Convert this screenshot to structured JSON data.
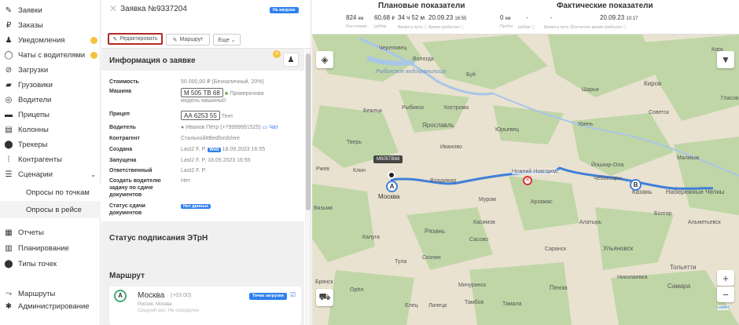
{
  "sidebar": {
    "items": [
      {
        "label": "Заявки",
        "icon": "edit-icon"
      },
      {
        "label": "Заказы",
        "icon": "ruble-icon"
      },
      {
        "label": "Уведомления",
        "icon": "bell-icon"
      },
      {
        "label": "Чаты с водителями",
        "icon": "chat-icon"
      },
      {
        "label": "Загрузки",
        "icon": "upload-icon"
      },
      {
        "label": "Грузовики",
        "icon": "truck-icon"
      },
      {
        "label": "Водители",
        "icon": "steering-icon"
      },
      {
        "label": "Прицепы",
        "icon": "trailer-icon"
      },
      {
        "label": "Колонны",
        "icon": "convoy-icon"
      },
      {
        "label": "Трекеры",
        "icon": "pin-icon"
      },
      {
        "label": "Контрагенты",
        "icon": "contractor-icon"
      },
      {
        "label": "Сценарии",
        "icon": "list-icon"
      }
    ],
    "subitems": [
      "Опросы по точкам",
      "Опросы в рейсе"
    ],
    "bottom": [
      {
        "label": "Отчеты",
        "icon": "report-icon"
      },
      {
        "label": "Планирование",
        "icon": "calendar-icon"
      },
      {
        "label": "Типы точек",
        "icon": "pin-icon"
      },
      {
        "label": "Маршруты",
        "icon": "route-icon"
      },
      {
        "label": "Администрирование",
        "icon": "gear-icon"
      }
    ]
  },
  "order": {
    "close": "✕",
    "title": "Заявка №9337204",
    "status": "На загрузке",
    "edit_label": "Редактировать",
    "route_label": "Маршрут",
    "more_label": "Еще ⌄"
  },
  "info": {
    "title": "Информация о заявке",
    "badge": "4",
    "rows": [
      {
        "k": "Стоимость",
        "v": "50 000,00 ₽ (Безналичный, 20%)"
      },
      {
        "k": "Машина",
        "plate": "М 505 ТВ 68",
        "check": "Проверочная",
        "model": "модель машины0"
      },
      {
        "k": "Прицеп",
        "plate": "АА 6253 55",
        "v": "Тент"
      },
      {
        "k": "Водитель",
        "v": "Иванов Пётр (+79999991525)",
        "chat": "Чат"
      },
      {
        "k": "Контрагент",
        "v": "Стальной#Bedfordshire"
      },
      {
        "k": "Создана",
        "v": "Last2 F. P.",
        "web": "Web",
        "date": "18.09.2023 16:55"
      },
      {
        "k": "Запущена",
        "v": "Last2 F. P. 18.09.2023 16:55"
      },
      {
        "k": "Ответственный",
        "v": "Last2 F. P."
      },
      {
        "k": "Создать водителю задачу по сдаче документов",
        "v": "Нет"
      },
      {
        "k": "Статус сдачи документов",
        "tag": "Нет данных"
      }
    ]
  },
  "etrn": {
    "title": "Статус подписания ЭТрН"
  },
  "route": {
    "title": "Маршрут",
    "point_city": "Москва",
    "point_tz": "(+03:00)",
    "point_region": "Россия, Москва",
    "point_sub": "Средний вес: Не определен",
    "point_tag": "Точка загрузки",
    "marker": "А"
  },
  "plan": {
    "title": "Плановые показатели",
    "dist": "824",
    "dist_unit": "км",
    "cost": "60,68",
    "cost_unit": "₽",
    "time": "34 ч 52 м",
    "arrive": "20.09.23",
    "arrive_time": "16:55",
    "l1": "Расстояние",
    "l2": "руб/км",
    "l3": "Время в пути ⓘ",
    "l4": "Время прибытия ⓘ"
  },
  "fact": {
    "title": "Фактические показатели",
    "dist": "0",
    "dist_unit": "км",
    "cost": "-",
    "time": "-",
    "arrive": "20.09.23",
    "arrive_time": "10:17",
    "l1": "Пробег",
    "l2": "руб/км ⓘ",
    "l3": "Время в пути ⓘ",
    "l4": "Расчетное время прибытия ⓘ"
  },
  "map": {
    "truck_label": "M505TB68",
    "marker_a": "A",
    "marker_b": "B",
    "attribution": "Leaflet",
    "cities": [
      "Череповец",
      "Вологда",
      "Рыбинское водохранилище",
      "Буй",
      "Шарья",
      "Киров",
      "Бежецк",
      "Рыбинск",
      "Кострома",
      "Ярославль",
      "Юрьевец",
      "Урень",
      "Тверь",
      "Иваново",
      "Клин",
      "Ржев",
      "Москва",
      "Владимир",
      "Нижний Новгород",
      "Йошкар-Ола",
      "Казань",
      "Набережные Челны",
      "Муром",
      "Арзамас",
      "Чебоксары",
      "Калуга",
      "Рязань",
      "Тула",
      "Саранск",
      "Ульяновск",
      "Тольятти",
      "Брянск",
      "Орёл",
      "Мичуринск",
      "Пенза",
      "Самара",
      "Вязьма",
      "Касимов",
      "Скопин",
      "Сасово",
      "Алатырь",
      "Болгар",
      "Альметьевск",
      "Николаевка",
      "Тамбов",
      "Елец",
      "Липецк",
      "Тамала",
      "Гласов",
      "Советск",
      "Малмыж",
      "Кирс"
    ]
  }
}
